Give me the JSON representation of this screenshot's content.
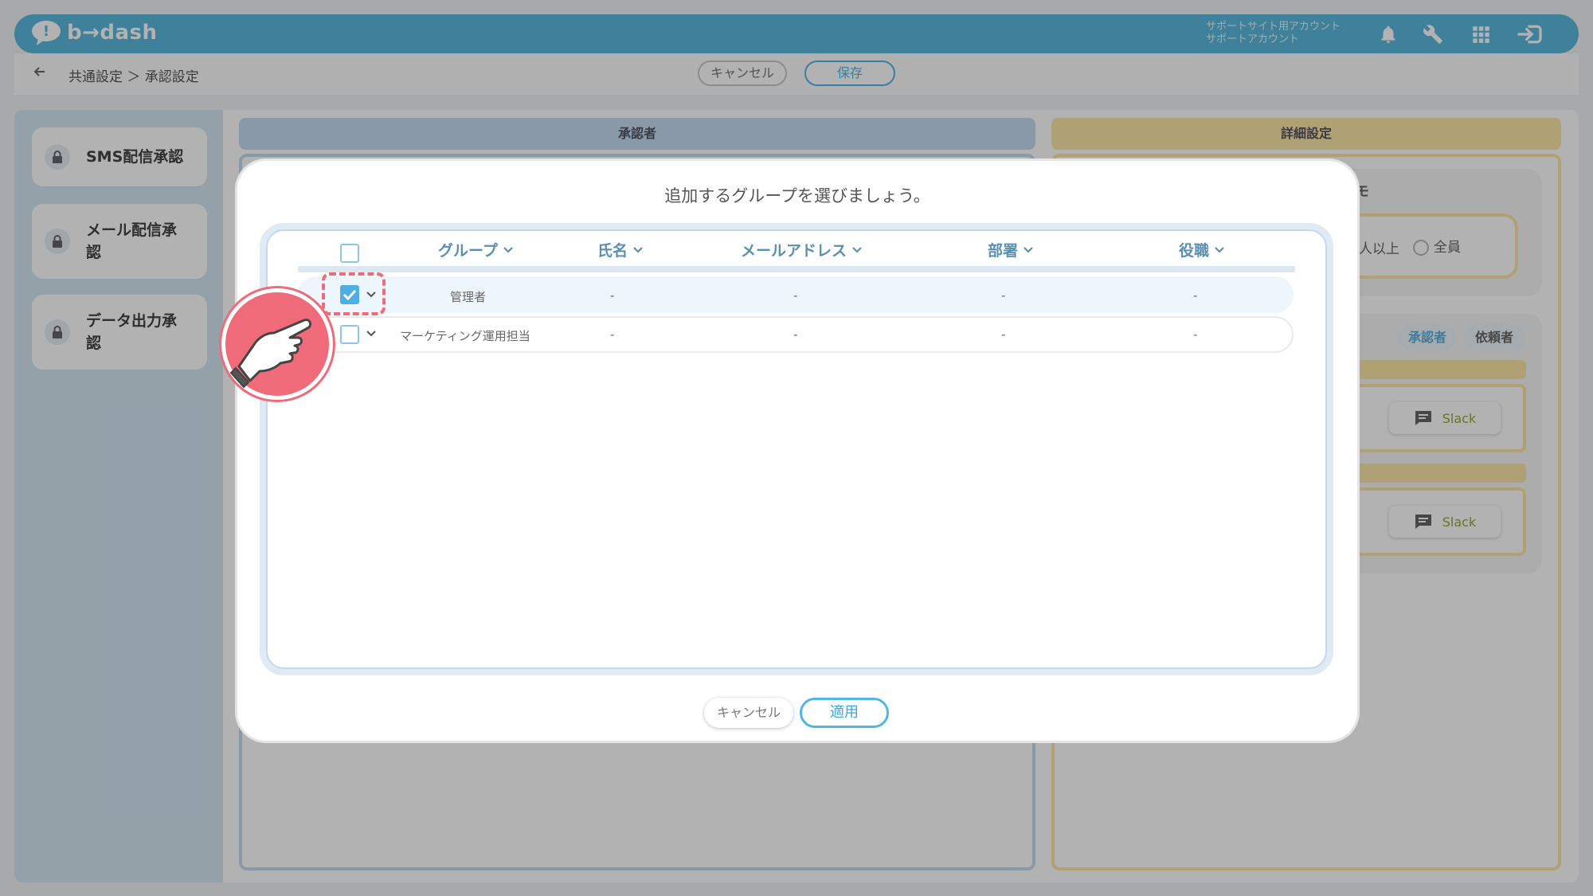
{
  "brand": {
    "logo_text": "b→dash",
    "accent": "#5bb9df"
  },
  "header": {
    "account_line1": "サポートサイト用アカウント",
    "account_line2": "サポートアカウント",
    "icons": [
      "bell-icon",
      "wrench-icon",
      "apps-grid-icon",
      "logout-icon"
    ]
  },
  "subbar": {
    "breadcrumb": "共通設定 ＞ 承認設定",
    "cancel_label": "キャンセル",
    "save_label": "保存"
  },
  "sidebar": {
    "items": [
      {
        "label": "SMS配信承認"
      },
      {
        "label": "メール配信承認"
      },
      {
        "label": "データ出力承認"
      }
    ]
  },
  "main": {
    "approvers_header": "承認者",
    "details_header": "詳細設定",
    "partial_title": "モ",
    "option_partial": "人以上",
    "option_all": "全員",
    "tab_approver": "承認者",
    "tab_requester": "依頼者",
    "slack_label": "Slack"
  },
  "modal": {
    "title": "追加するグループを選びましょう。",
    "columns": [
      "グループ",
      "氏名",
      "メールアドレス",
      "部署",
      "役職"
    ],
    "rows": [
      {
        "checked": true,
        "group": "管理者",
        "name": "-",
        "email": "-",
        "dept": "-",
        "role": "-"
      },
      {
        "checked": false,
        "group": "マーケティング運用担当",
        "name": "-",
        "email": "-",
        "dept": "-",
        "role": "-"
      }
    ],
    "cancel_label": "キャンセル",
    "apply_label": "適用"
  }
}
